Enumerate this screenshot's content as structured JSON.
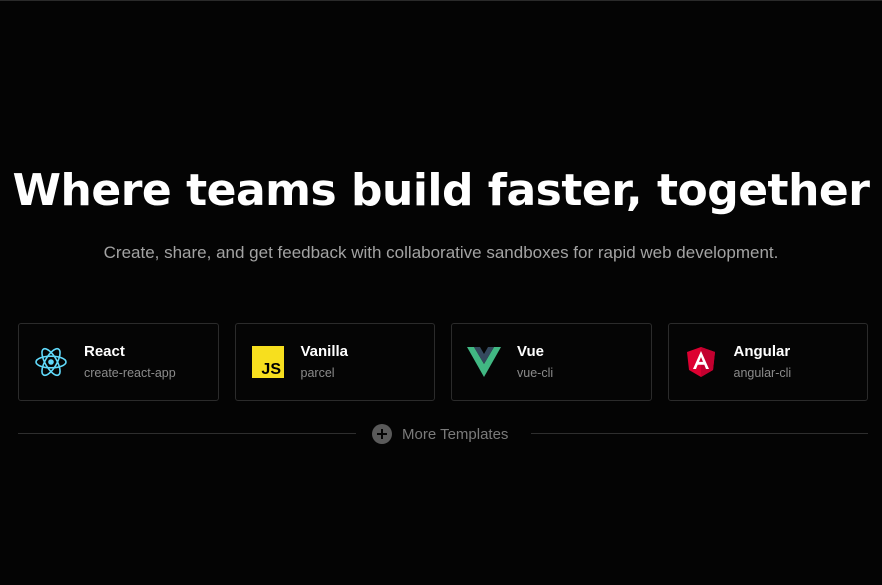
{
  "hero": {
    "title": "Where teams build faster, together",
    "subtitle": "Create, share, and get feedback with collaborative sandboxes for rapid web development."
  },
  "templates": [
    {
      "title": "React",
      "subtitle": "create-react-app",
      "icon": "react-icon",
      "color": "#61dafb"
    },
    {
      "title": "Vanilla",
      "subtitle": "parcel",
      "icon": "js-icon",
      "color": "#f7df1e"
    },
    {
      "title": "Vue",
      "subtitle": "vue-cli",
      "icon": "vue-icon",
      "color": "#41b883"
    },
    {
      "title": "Angular",
      "subtitle": "angular-cli",
      "icon": "angular-icon",
      "color": "#dd0031"
    }
  ],
  "more": {
    "label": "More Templates",
    "icon": "plus-circle-icon"
  },
  "colors": {
    "background": "#040404",
    "text": "#ffffff",
    "muted": "#a3a3a3",
    "border": "#2b2b2b"
  }
}
